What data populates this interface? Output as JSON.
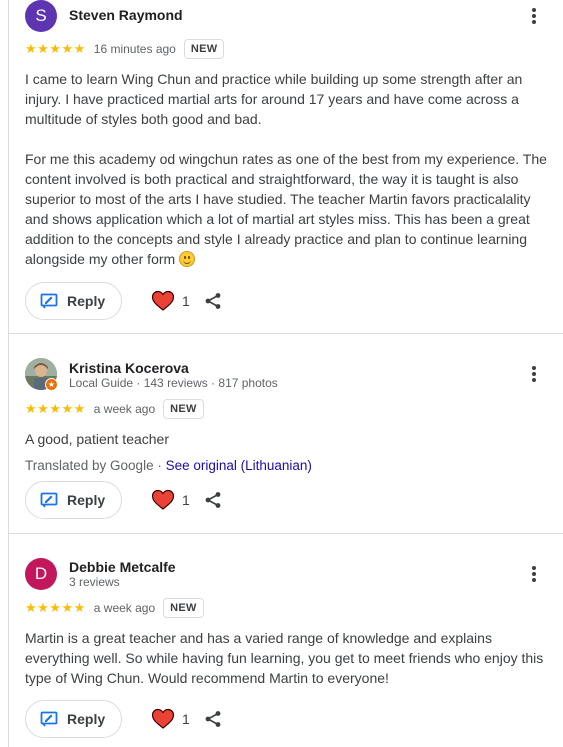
{
  "reviews": [
    {
      "avatar_letter": "S",
      "avatar_color": "#5e35b1",
      "name": "Steven Raymond",
      "stars": "★★★★★",
      "time": "16 minutes ago",
      "badge": "NEW",
      "text_p1": "I came to learn Wing Chun and practice while building up some strength after an injury. I have practiced martial arts for around 17 years and have come across a multitude of styles both good and bad.",
      "text_p2": "For me this academy od wingchun rates as one of the best from my experience. The content involved is both practical and straightforward, the way it is taught is also superior to most of the arts I have studied. The teacher Martin favors practicalality and shows application which a lot of martial art styles miss. This has been a great addition to the concepts and style I already practice and plan to continue learning alongside my other form",
      "reply_label": "Reply",
      "likes": "1"
    },
    {
      "name": "Kristina Kocerova",
      "meta": "Local Guide · 143 reviews · 817 photos",
      "stars": "★★★★★",
      "time": "a week ago",
      "badge": "NEW",
      "text": "A good, patient teacher",
      "translated_by": "Translated by Google · ",
      "see_original": "See original (Lithuanian)",
      "reply_label": "Reply",
      "likes": "1"
    },
    {
      "avatar_letter": "D",
      "avatar_color": "#c2185b",
      "name": "Debbie Metcalfe",
      "meta": "3 reviews",
      "stars": "★★★★★",
      "time": "a week ago",
      "badge": "NEW",
      "text": "Martin is a great teacher and has a varied range of knowledge and explains everything well. So while having fun learning, you get to meet friends who enjoy this type of Wing Chun. Would recommend Martin to everyone!",
      "reply_label": "Reply",
      "likes": "1"
    }
  ],
  "colors": {
    "star": "#fbbc04",
    "link": "#1a0dab",
    "reply_icon": "#1a73e8",
    "heart": "#ea4335"
  },
  "icons": [
    "more-vert-icon",
    "reply-icon",
    "heart-icon",
    "share-icon",
    "smiley-emoji"
  ]
}
